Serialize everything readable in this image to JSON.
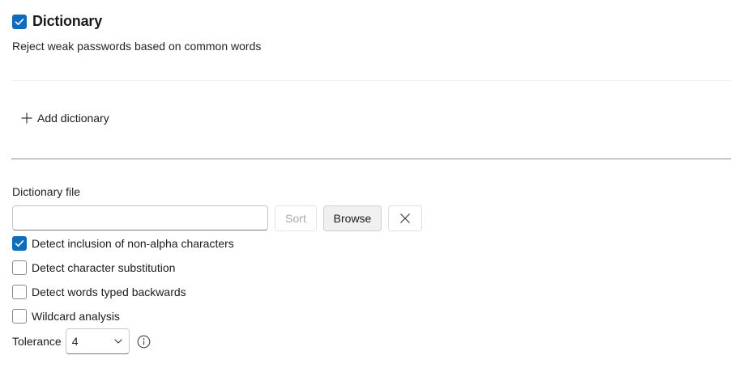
{
  "header": {
    "title": "Dictionary",
    "checked": true
  },
  "description": "Reject weak passwords based on common words",
  "add_dictionary": {
    "label": "Add dictionary",
    "icon": "plus-icon"
  },
  "dictionary_file": {
    "label": "Dictionary file",
    "value": "",
    "sort_label": "Sort",
    "browse_label": "Browse",
    "clear_icon": "close-icon"
  },
  "options": [
    {
      "label": "Detect inclusion of non-alpha characters",
      "checked": true
    },
    {
      "label": "Detect character substitution",
      "checked": false
    },
    {
      "label": "Detect words typed backwards",
      "checked": false
    },
    {
      "label": "Wildcard analysis",
      "checked": false
    }
  ],
  "tolerance": {
    "label": "Tolerance",
    "value": "4",
    "info_icon": "info-icon"
  },
  "colors": {
    "accent": "#0f6cbd"
  }
}
